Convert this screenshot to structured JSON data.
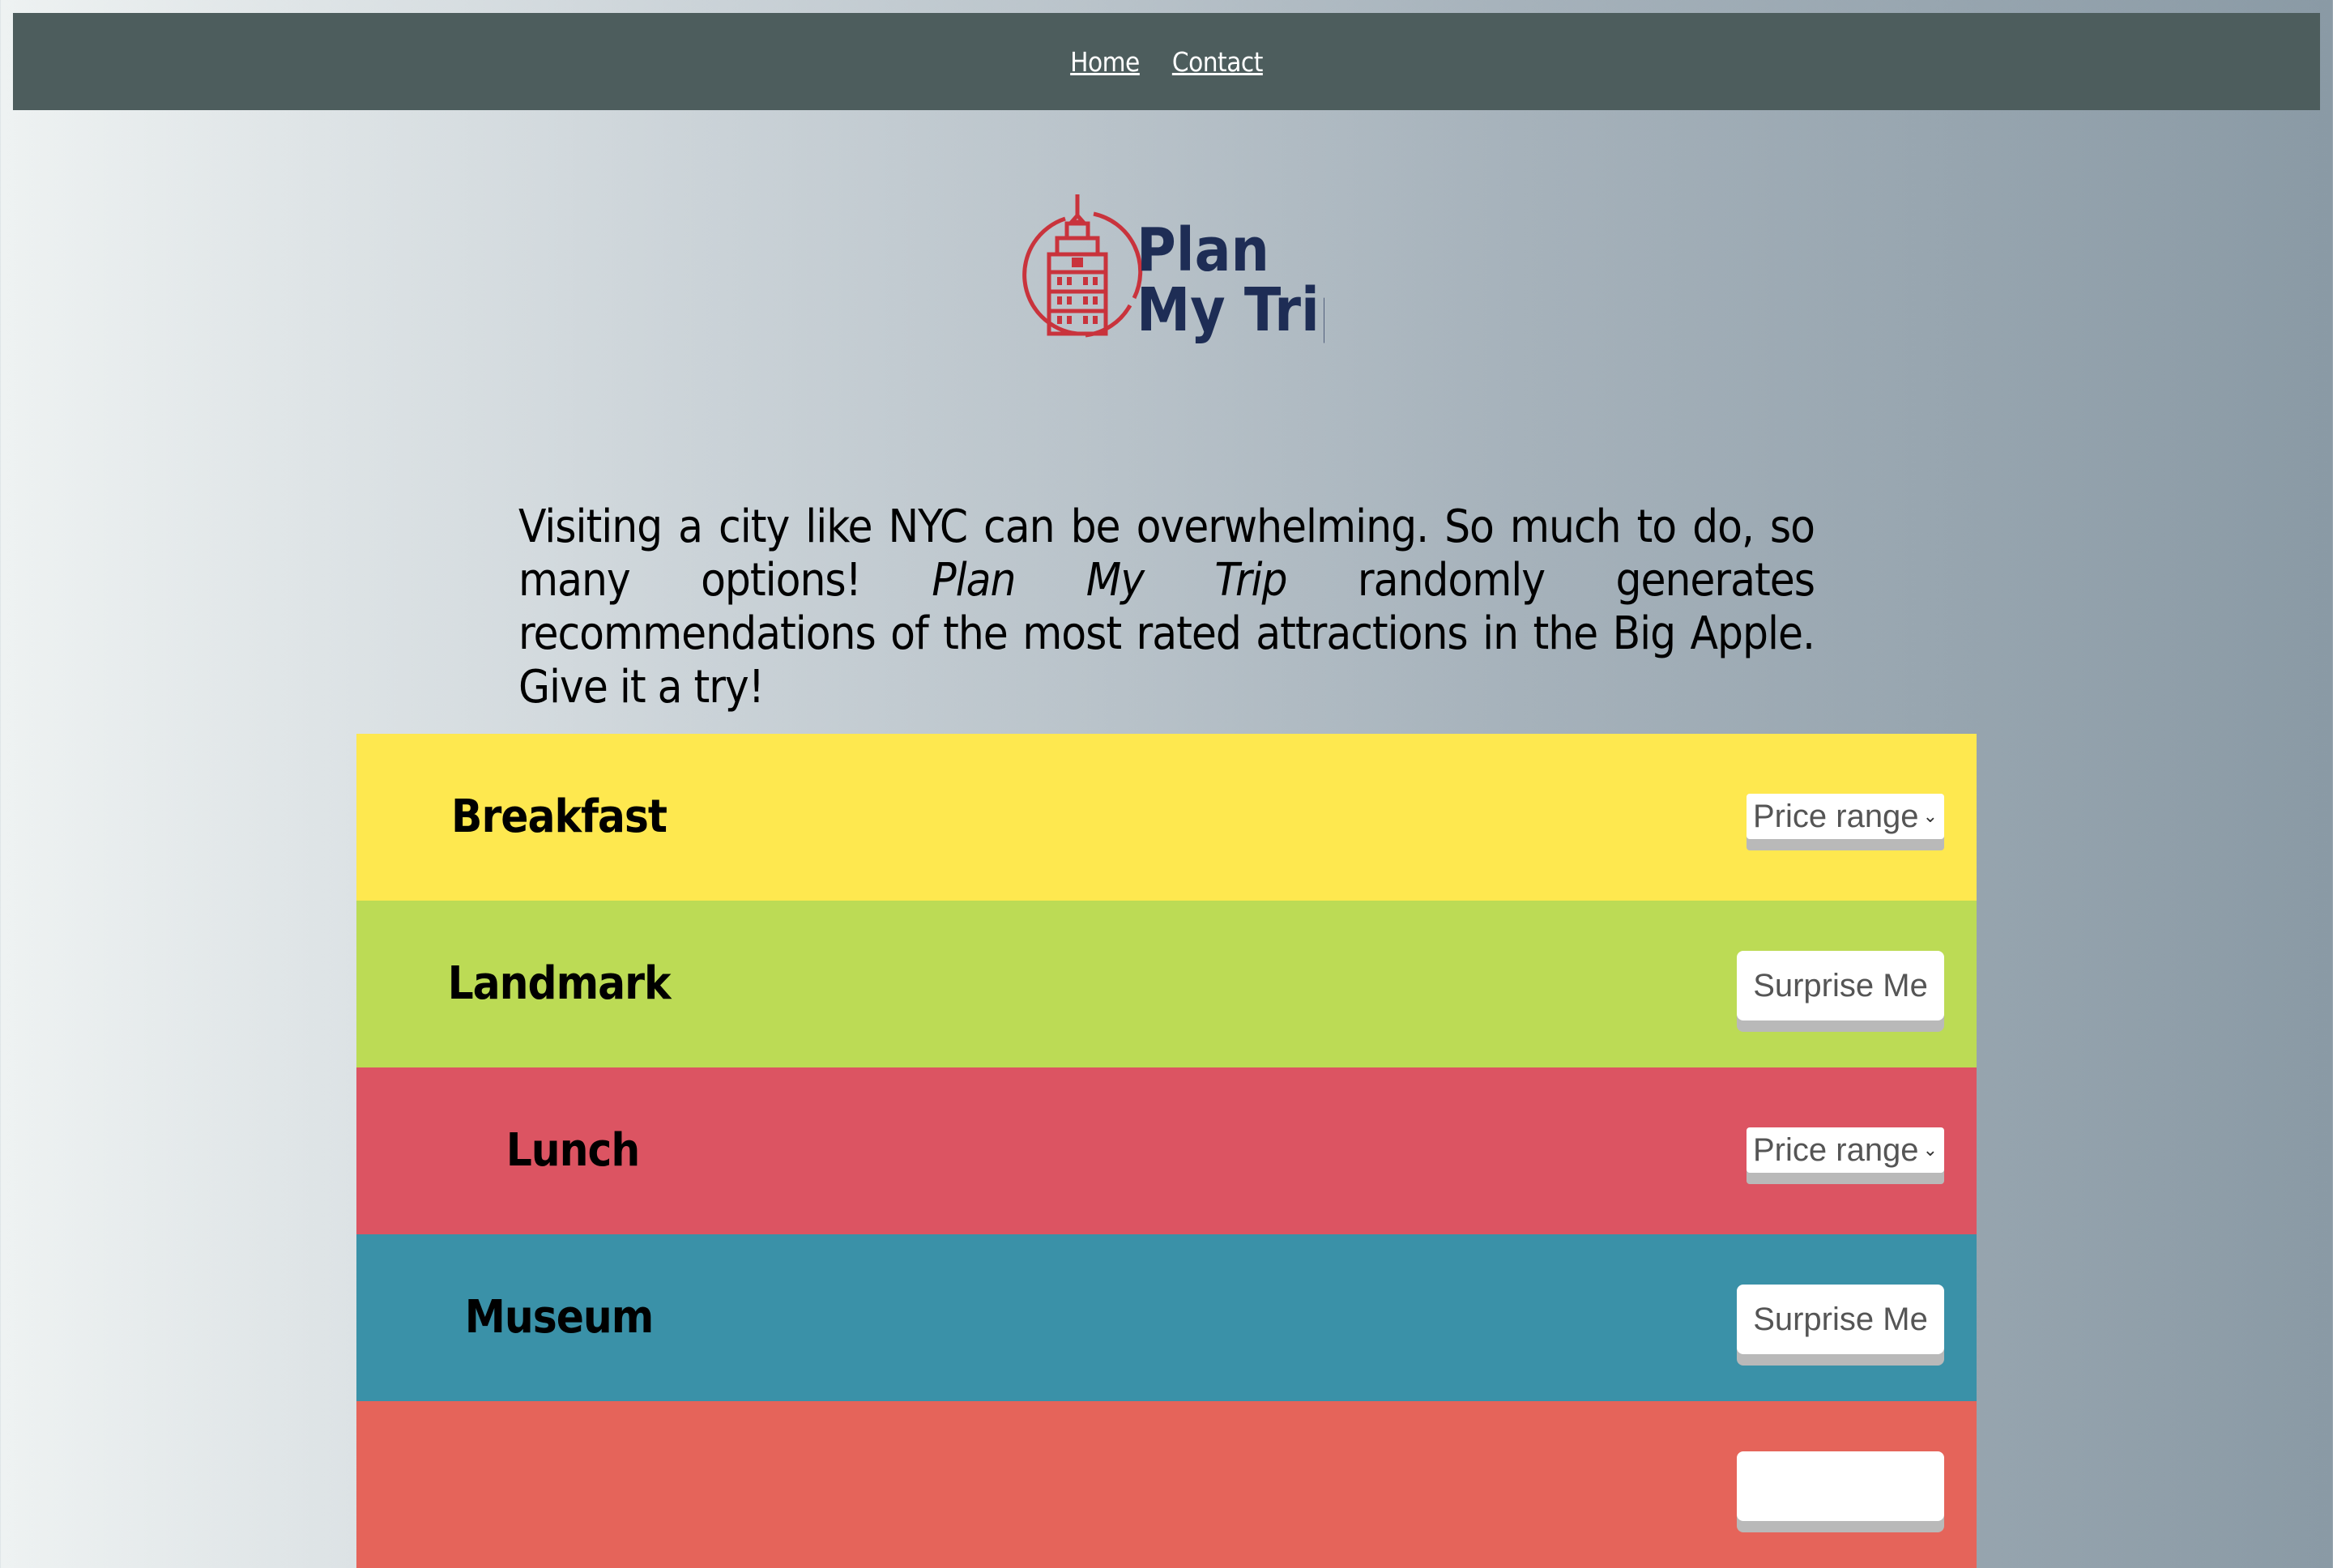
{
  "nav": {
    "links": [
      "Home",
      "Contact"
    ]
  },
  "logo": {
    "line1": "Plan",
    "line2": "My Trip"
  },
  "intro": {
    "before": "Visiting a city like NYC can be overwhelming. So much to do, so many options! ",
    "emphasis": "Plan My Trip",
    "after": " randomly generates recommendations of the most rated attractions in the Big Apple. Give it a try!"
  },
  "sections": [
    {
      "title": "Breakfast",
      "control": "Price range",
      "color": "#fee84f"
    },
    {
      "title": "Landmark",
      "control": "Surprise Me",
      "color": "#bcdb55"
    },
    {
      "title": "Lunch",
      "control": "Price range",
      "color": "#dc5462"
    },
    {
      "title": "Museum",
      "control": "Surprise Me",
      "color": "#3a91a8"
    },
    {
      "title": "",
      "control": "",
      "color": "#e5645a"
    }
  ],
  "colors": {
    "nav_bg": "#4d5d5d",
    "logo_red": "#c9333c",
    "logo_navy": "#1e2d55"
  }
}
